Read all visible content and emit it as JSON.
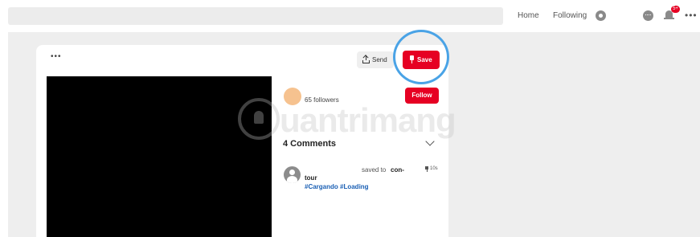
{
  "topbar": {
    "nav": {
      "home_label": "Home",
      "following_label": "Following"
    },
    "notification_badge": "5+",
    "more_label": "•••",
    "icons": [
      "settings-icon",
      "messages-icon",
      "bell-icon",
      "more-icon"
    ]
  },
  "pin": {
    "more_label": "•••",
    "send_label": "Send",
    "save_label": "Save",
    "creator": {
      "followers_label": "65 followers",
      "follow_label": "Follow"
    },
    "comments": {
      "title": "4 Comments",
      "items": [
        {
          "user": "tour",
          "saved_to_label": "saved to",
          "board": "con-",
          "time": "10s",
          "hashtags": "#Cargando #Loading"
        }
      ]
    }
  },
  "watermark": {
    "text": "uantrimang"
  },
  "colors": {
    "brand_red": "#e60023",
    "highlight_blue": "#4aa3e6",
    "hashtag_blue": "#1a5fb4"
  }
}
